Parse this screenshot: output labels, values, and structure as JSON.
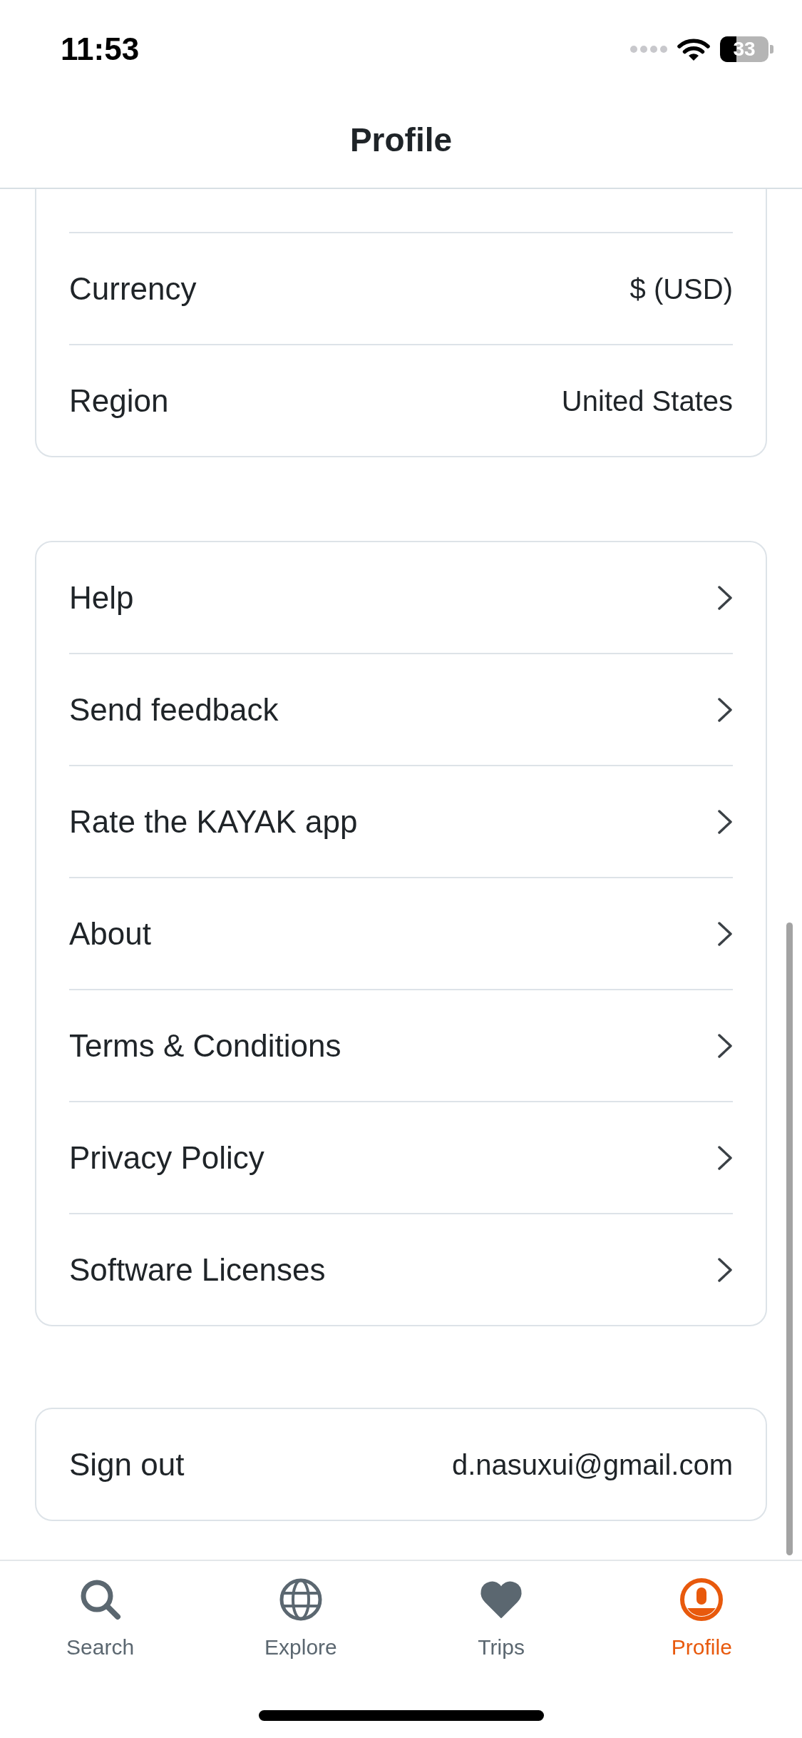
{
  "status_bar": {
    "time": "11:53",
    "battery": "33"
  },
  "header": {
    "title": "Profile"
  },
  "sections": [
    {
      "rows": [
        {
          "kind": "value",
          "label": "Currency",
          "value": "$ (USD)"
        },
        {
          "kind": "value",
          "label": "Region",
          "value": "United States"
        }
      ]
    },
    {
      "rows": [
        {
          "kind": "link",
          "label": "Help"
        },
        {
          "kind": "link",
          "label": "Send feedback"
        },
        {
          "kind": "link",
          "label": "Rate the KAYAK app"
        },
        {
          "kind": "link",
          "label": "About"
        },
        {
          "kind": "link",
          "label": "Terms & Conditions"
        },
        {
          "kind": "link",
          "label": "Privacy Policy"
        },
        {
          "kind": "link",
          "label": "Software Licenses"
        }
      ]
    },
    {
      "rows": [
        {
          "kind": "value",
          "label": "Sign out",
          "value": "d.nasuxui@gmail.com"
        }
      ]
    }
  ],
  "tab_bar": {
    "tabs": [
      {
        "label": "Search",
        "selected": false
      },
      {
        "label": "Explore",
        "selected": false
      },
      {
        "label": "Trips",
        "selected": false
      },
      {
        "label": "Profile",
        "selected": true
      }
    ]
  }
}
